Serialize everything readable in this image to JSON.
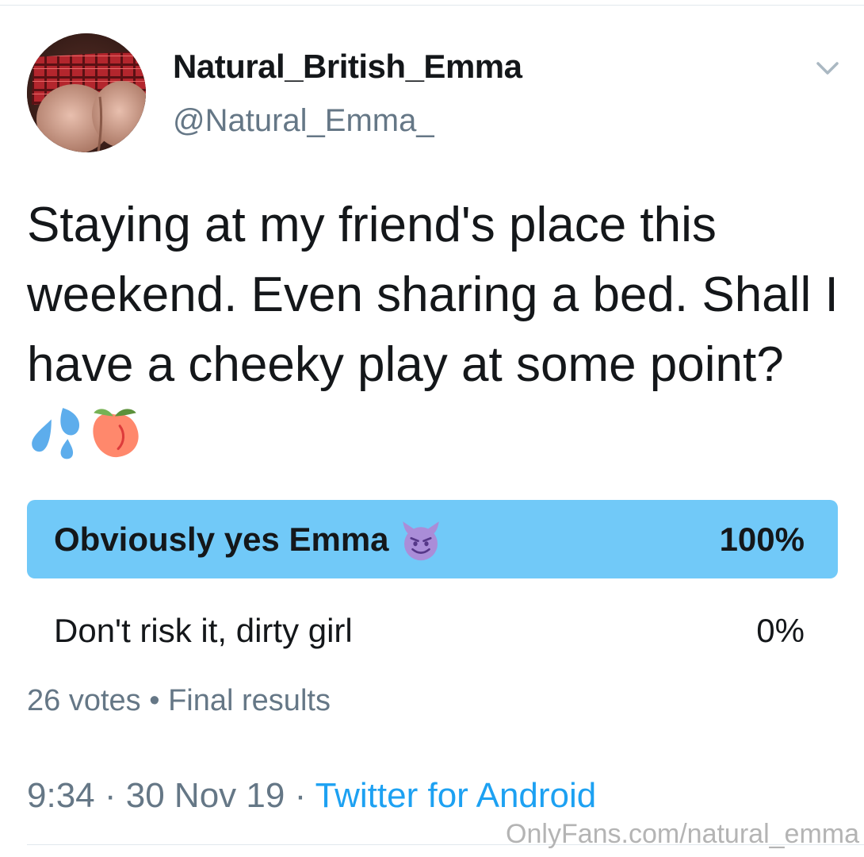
{
  "user": {
    "display_name": "Natural_British_Emma",
    "handle": "@Natural_Emma_",
    "avatar_icon": "profile-photo"
  },
  "menu_icon": "chevron-down-icon",
  "tweet": {
    "text": "Staying at my friend's place this weekend. Even sharing a bed. Shall I have a cheeky play at some point?",
    "emojis": [
      "sweat-droplets-icon",
      "peach-icon"
    ]
  },
  "poll": {
    "options": [
      {
        "label": "Obviously yes Emma",
        "emoji": "smiling-devil-icon",
        "percent": "100%",
        "fraction": 1.0,
        "winner": true
      },
      {
        "label": "Don't risk it, dirty girl",
        "percent": "0%",
        "fraction": 0.0,
        "winner": false
      }
    ],
    "votes": "26 votes",
    "separator": "•",
    "status": "Final results"
  },
  "meta": {
    "time": "9:34",
    "date": "30 Nov 19",
    "dot": "·",
    "source": "Twitter for Android"
  },
  "watermark": "OnlyFans.com/natural_emma",
  "colors": {
    "accent": "#1da1f2",
    "poll_winner": "#71c9f8",
    "secondary_text": "#657786",
    "primary_text": "#14171a"
  }
}
